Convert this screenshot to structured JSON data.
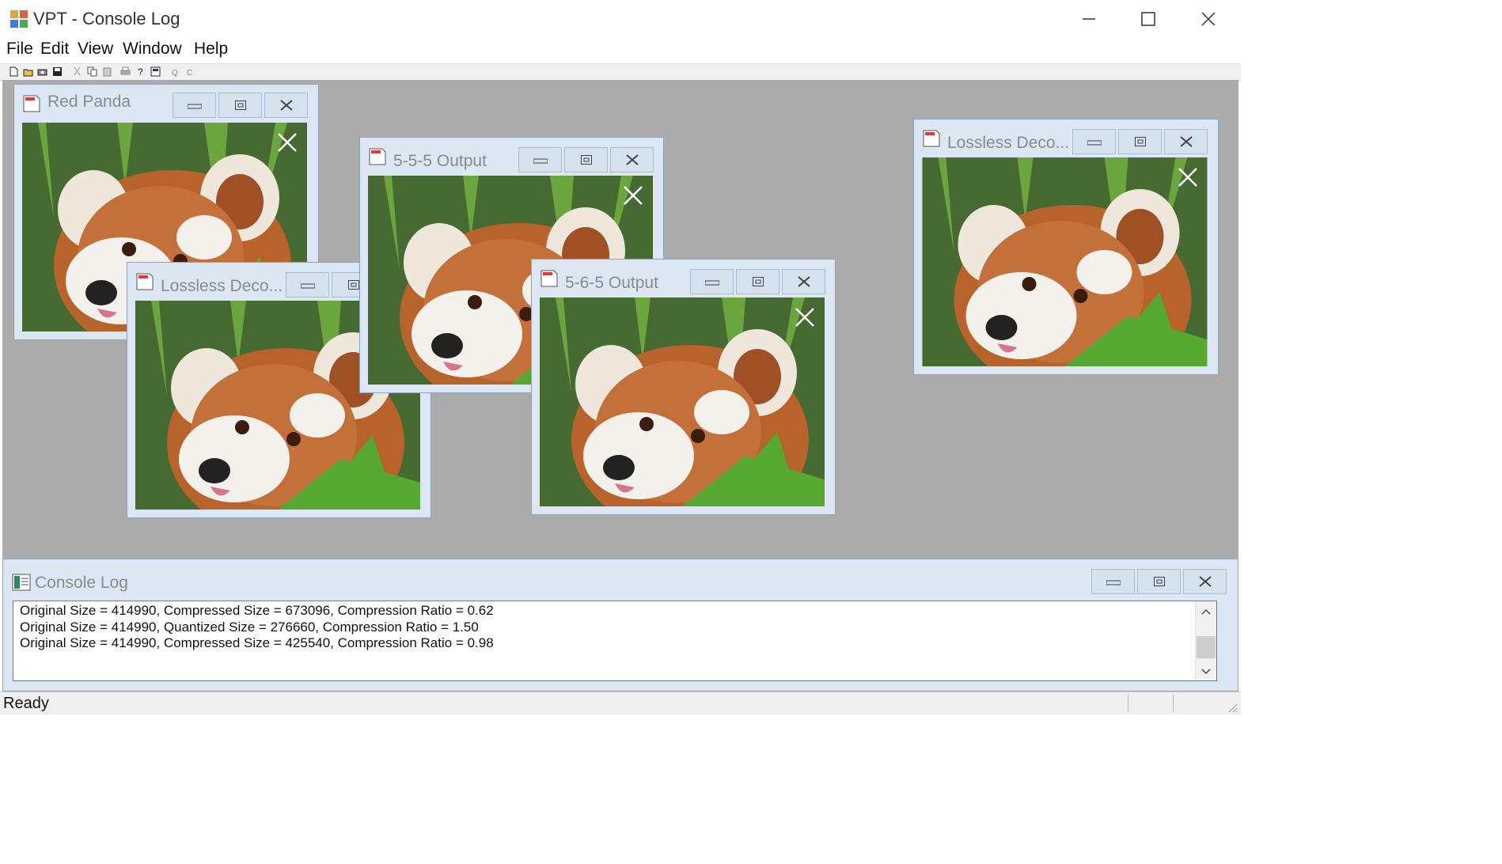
{
  "app": {
    "title": "VPT - Console Log"
  },
  "menu": [
    "File",
    "Edit",
    "View",
    "Window",
    "Help"
  ],
  "windows": [
    {
      "title": "Red Panda"
    },
    {
      "title": "Lossless Deco..."
    },
    {
      "title": "5-5-5 Output"
    },
    {
      "title": "5-6-5 Output"
    },
    {
      "title": "Lossless Deco..."
    }
  ],
  "console": {
    "title": "Console Log",
    "lines": [
      "Original Size = 414990, Compressed Size = 673096, Compression Ratio = 0.62",
      "Original Size = 414990, Quantized Size = 276660, Compression Ratio = 1.50",
      "Original Size = 414990, Compressed Size = 425540, Compression Ratio = 0.98"
    ]
  },
  "status": {
    "text": "Ready"
  }
}
